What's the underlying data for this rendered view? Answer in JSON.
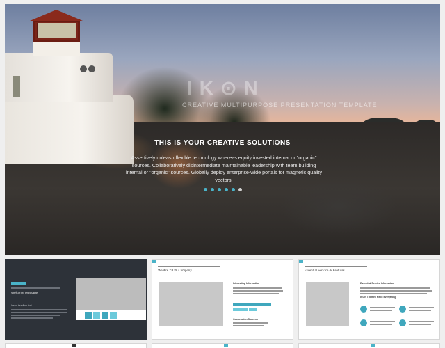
{
  "hero": {
    "logo_text": "IK⊙N",
    "logo_subtitle": "CREATIVE MULTIPURPOSE PRESENTATION TEMPLATE",
    "title": "THIS IS YOUR CREATIVE SOLUTIONS",
    "body": "Assertively unleash flexible technology whereas equity invested internal or \"organic\" sources. Collaboratively disintermediate maintainable leadership with team building internal or \"organic\" sources. Globally deploy enterprise-wide portals for magnetic quality vectors.",
    "slide_count": 6,
    "active_slide": 6
  },
  "thumbnails": [
    {
      "title": "Welcome Message",
      "subtitle": "Insert headline text"
    },
    {
      "title": "We Are ZION Company",
      "subtitle": "Interesting Information",
      "caption": "Cooperation Success"
    },
    {
      "title": "Essential Service & Features",
      "subtitle": "Essential Service Information",
      "caption": "ICON Theme / Hello Everything"
    }
  ],
  "colors": {
    "accent": "#4ab3c8",
    "accent_light": "#6ccadb",
    "dark_slide": "#2d3239"
  }
}
